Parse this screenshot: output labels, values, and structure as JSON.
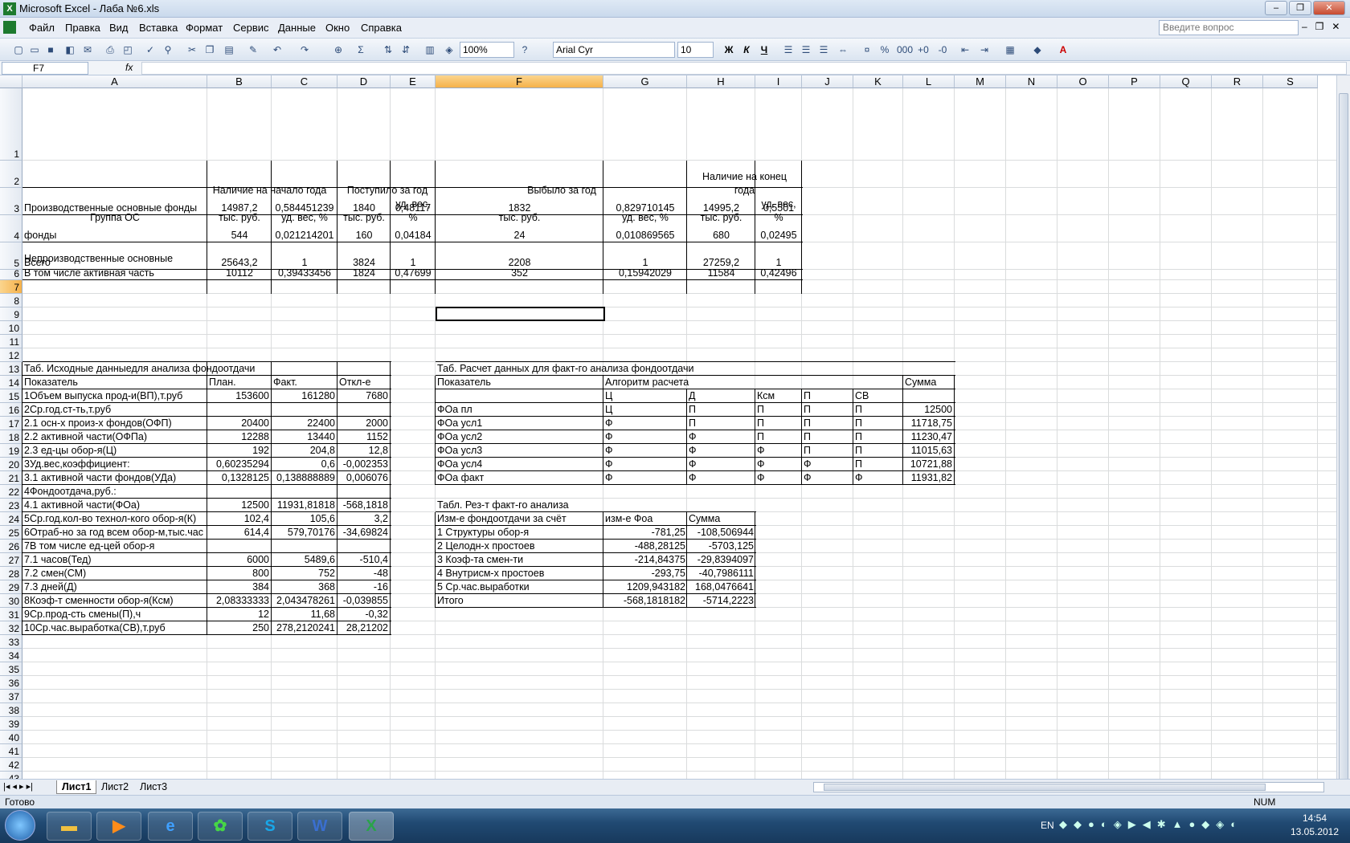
{
  "window": {
    "title": "Microsoft Excel - Лаба №6.xls",
    "min_label": "–",
    "max_label": "❐",
    "close_label": "✕"
  },
  "menu": [
    "Файл",
    "Правка",
    "Вид",
    "Вставка",
    "Формат",
    "Сервис",
    "Данные",
    "Окно",
    "Справка"
  ],
  "help_placeholder": "Введите вопрос",
  "toolbar": {
    "zoom": "100%",
    "font": "Arial Cyr",
    "size": "10",
    "bold": "Ж",
    "italic": "К",
    "underline": "Ч"
  },
  "namebox": "F7",
  "fx": "fx",
  "columns": [
    "A",
    "B",
    "C",
    "D",
    "E",
    "F",
    "G",
    "H",
    "I",
    "J",
    "K",
    "L",
    "M",
    "N",
    "O",
    "P",
    "Q",
    "R",
    "S"
  ],
  "rows": [
    "1",
    "2",
    "3",
    "4",
    "5",
    "6",
    "7",
    "8",
    "9",
    "10",
    "11",
    "12",
    "13",
    "14",
    "15",
    "16",
    "17",
    "18",
    "19",
    "20",
    "21",
    "22",
    "23",
    "24",
    "25",
    "26",
    "27",
    "28",
    "29",
    "30",
    "31",
    "32",
    "33",
    "34",
    "35",
    "36",
    "37",
    "38",
    "39",
    "40",
    "41",
    "42",
    "43",
    "44",
    "45",
    "46",
    "47"
  ],
  "table1": {
    "hdr_b1": "Наличие на начало года",
    "hdr_d1": "Поступило за год",
    "hdr_f1": "Выбыло за год",
    "hdr_h1a": "Наличие на конец",
    "hdr_h1b": "года",
    "a2": "Группа ОС",
    "b2": "тыс. руб.",
    "c2": "уд. вес, %",
    "d2": "тыс. руб.",
    "e2a": "уд. вес,",
    "e2b": "%",
    "f2": "тыс. руб.",
    "g2": "уд. вес, %",
    "h2": "тыс. руб.",
    "i2a": "уд. вес,",
    "i2b": "%",
    "r3": [
      "Производственные основные фонды",
      "14987,2",
      "0,584451239",
      "1840",
      "0,48117",
      "1832",
      "0,829710145",
      "14995,2",
      "0,5501"
    ],
    "r4a": "Непроизводственные основные",
    "r4": [
      "фонды",
      "544",
      "0,021214201",
      "160",
      "0,04184",
      "24",
      "0,010869565",
      "680",
      "0,02495"
    ],
    "r5": [
      "Всего",
      "25643,2",
      "1",
      "3824",
      "1",
      "2208",
      "1",
      "27259,2",
      "1"
    ],
    "r6": [
      "В том числе активная часть",
      "10112",
      "0,39433456",
      "1824",
      "0,47699",
      "352",
      "0,15942029",
      "11584",
      "0,42496"
    ]
  },
  "table2": {
    "title": "Таб. Исходные данныедля анализа фондоотдачи",
    "header": [
      "Показатель",
      "План.",
      "Факт.",
      "Откл-е"
    ],
    "rows": [
      [
        "1Объем выпуска прод-и(ВП),т.руб",
        "153600",
        "161280",
        "7680"
      ],
      [
        "2Ср.год.ст-ть,т.руб",
        "",
        "",
        ""
      ],
      [
        "2.1 осн-х произ-х фондов(ОФП)",
        "20400",
        "22400",
        "2000"
      ],
      [
        "2.2 активной части(ОФПа)",
        "12288",
        "13440",
        "1152"
      ],
      [
        "2.3 ед-цы обор-я(Ц)",
        "192",
        "204,8",
        "12,8"
      ],
      [
        "3Уд.вес,коэффициент:",
        "0,60235294",
        "0,6",
        "-0,002353"
      ],
      [
        "3.1 активной части фондов(УДа)",
        "0,1328125",
        "0,138888889",
        "0,006076"
      ],
      [
        "4Фондоотдача,руб.:",
        "",
        "",
        ""
      ],
      [
        "4.1 активной части(ФОа)",
        "12500",
        "11931,81818",
        "-568,1818"
      ],
      [
        "5Ср.год.кол-во технол-кого обор-я(К)",
        "102,4",
        "105,6",
        "3,2"
      ],
      [
        "6Отраб-но за год всем обор-м,тыс.час",
        "614,4",
        "579,70176",
        "-34,69824"
      ],
      [
        "7В том числе ед-цей обор-я",
        "",
        "",
        ""
      ],
      [
        "7.1 часов(Тед)",
        "6000",
        "5489,6",
        "-510,4"
      ],
      [
        "7.2 смен(СМ)",
        "800",
        "752",
        "-48"
      ],
      [
        "7.3 дней(Д)",
        "384",
        "368",
        "-16"
      ],
      [
        "8Коэф-т сменности обор-я(Ксм)",
        "2,08333333",
        "2,043478261",
        "-0,039855"
      ],
      [
        "9Ср.прод-сть смены(П),ч",
        "12",
        "11,68",
        "-0,32"
      ],
      [
        "10Ср.час.выработка(СВ),т.руб",
        "250",
        "278,2120241",
        "28,21202"
      ]
    ]
  },
  "table3": {
    "title": "Таб. Расчет данных для факт-го анализа фондоотдачи",
    "hdr_a": "Показатель",
    "hdr_b": "Алгоритм расчета",
    "hdr_sum": "Сумма",
    "sub": [
      "Ц",
      "Д",
      "Ксм",
      "П",
      "СВ"
    ],
    "rows": [
      [
        "ФОа пл",
        "Ц",
        "П",
        "П",
        "П",
        "П",
        "12500"
      ],
      [
        "ФОа усл1",
        "Ф",
        "П",
        "П",
        "П",
        "П",
        "11718,75"
      ],
      [
        "ФОа усл2",
        "Ф",
        "Ф",
        "П",
        "П",
        "П",
        "11230,47"
      ],
      [
        "ФОа усл3",
        "Ф",
        "Ф",
        "Ф",
        "П",
        "П",
        "11015,63"
      ],
      [
        "ФОа усл4",
        "Ф",
        "Ф",
        "Ф",
        "Ф",
        "П",
        "10721,88"
      ],
      [
        "ФОа факт",
        "Ф",
        "Ф",
        "Ф",
        "Ф",
        "Ф",
        "11931,82"
      ]
    ]
  },
  "table4": {
    "title": "Табл. Рез-т факт-го анализа",
    "header": [
      "Изм-е фондоотдачи за счёт",
      "изм-е Фоа",
      "Сумма"
    ],
    "rows": [
      [
        "1 Структуры обор-я",
        "-781,25",
        "-108,506944"
      ],
      [
        "2 Целодн-х простоев",
        "-488,28125",
        "-5703,125"
      ],
      [
        "3 Коэф-та смен-ти",
        "-214,84375",
        "-29,8394097"
      ],
      [
        "4 Внутрисм-х простоев",
        "-293,75",
        "-40,7986111"
      ],
      [
        "5 Ср.час.выработки",
        "1209,943182",
        "168,0476641"
      ],
      [
        "Итого",
        "-568,1818182",
        "-5714,2223"
      ]
    ]
  },
  "sheets": [
    "Лист1",
    "Лист2",
    "Лист3"
  ],
  "status": {
    "ready": "Готово",
    "num": "NUM"
  },
  "taskbar": {
    "lang": "EN",
    "time": "14:54",
    "date": "13.05.2012"
  }
}
